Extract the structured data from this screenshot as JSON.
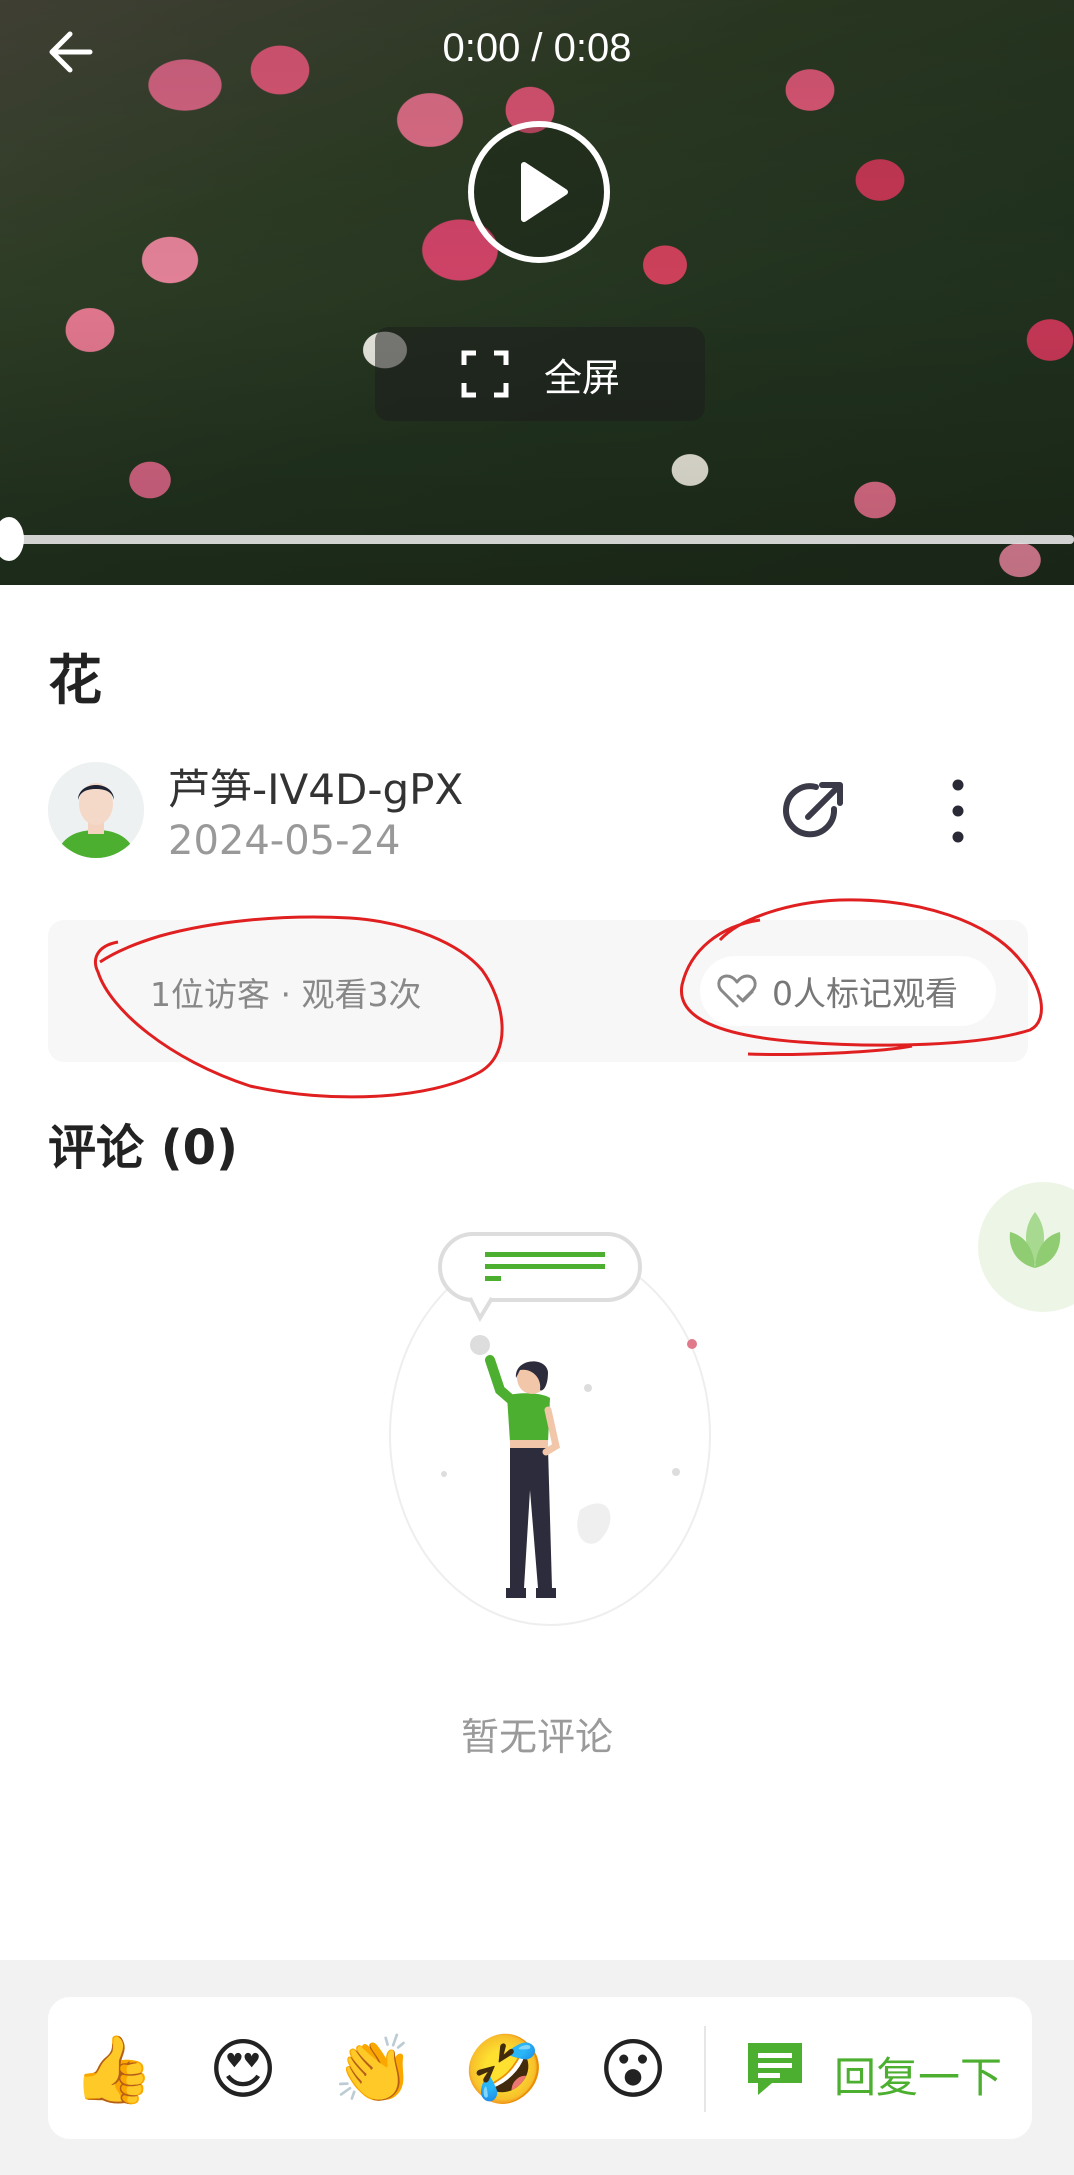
{
  "video": {
    "time": "0:00 / 0:08",
    "fullscreen_label": "全屏",
    "progress": 0
  },
  "post": {
    "title": "花",
    "author": "芦笋-IV4D-gPX",
    "date": "2024-05-24"
  },
  "stats": {
    "visitors_views": "1位访客 · 观看3次",
    "watch_marks": "0人标记观看"
  },
  "comments": {
    "title": "评论 (0)",
    "empty_text": "暂无评论"
  },
  "reactions": {
    "emojis": [
      "👍",
      "😍",
      "👏",
      "🤣",
      "😮"
    ],
    "reply_label": "回复一下"
  },
  "colors": {
    "accent_green": "#4caf2f",
    "annotation_red": "#e02020"
  },
  "icons": [
    "back-arrow-icon",
    "play-icon",
    "fullscreen-icon",
    "share-icon",
    "more-vertical-icon",
    "heart-icon",
    "leaf-icon",
    "comment-icon"
  ]
}
